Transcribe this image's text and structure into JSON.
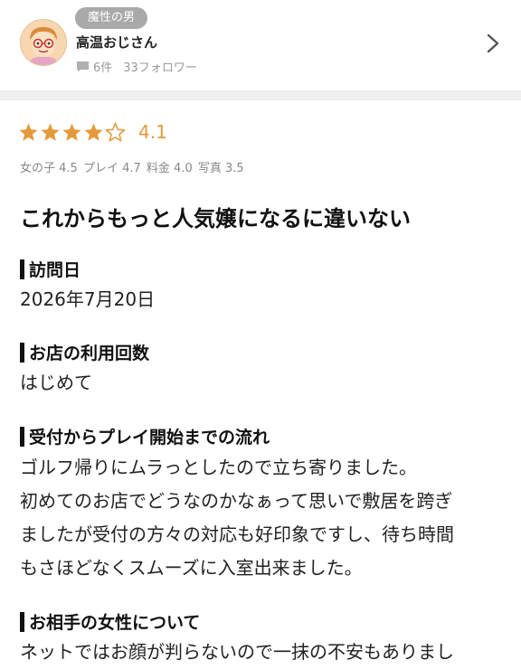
{
  "profile": {
    "badge": "魔性の男",
    "username": "高温おじさん",
    "post_count": "6件",
    "followers": "33フォロワー"
  },
  "rating": {
    "stars": 4,
    "max_stars": 5,
    "score": "4.1",
    "star_color": "#e49a3b",
    "subscores": [
      "女の子 4.5",
      "プレイ 4.7",
      "料金 4.0",
      "写真 3.5"
    ]
  },
  "review": {
    "title": "これからもっと人気嬢になるに違いない",
    "sections": [
      {
        "heading": "訪問日",
        "lines": [
          "2026年7月20日"
        ]
      },
      {
        "heading": "お店の利用回数",
        "lines": [
          "はじめて"
        ]
      },
      {
        "heading": "受付からプレイ開始までの流れ",
        "lines": [
          "ゴルフ帰りにムラっとしたので立ち寄りました。",
          "初めてのお店でどうなのかなぁって思いで敷居を跨ぎ",
          "ましたが受付の方々の対応も好印象ですし、待ち時間",
          "もさほどなくスムーズに入室出来ました。"
        ]
      },
      {
        "heading": "お相手の女性について",
        "lines": [
          "ネットではお顔が判らないので一抹の不安もありまし"
        ]
      }
    ]
  }
}
